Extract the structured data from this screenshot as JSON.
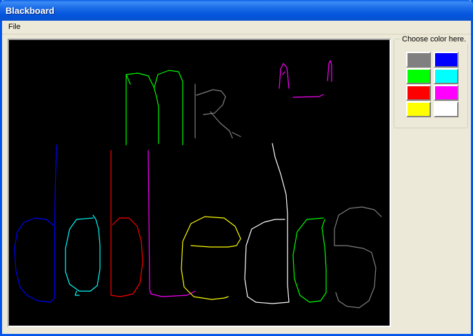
{
  "window": {
    "title": "Blackboard"
  },
  "menu": {
    "items": [
      "File"
    ]
  },
  "palette": {
    "label": "Choose color here.",
    "colors": [
      {
        "name": "gray",
        "hex": "#808080"
      },
      {
        "name": "blue",
        "hex": "#0000FF"
      },
      {
        "name": "green",
        "hex": "#00FF00"
      },
      {
        "name": "cyan",
        "hex": "#00FFFF"
      },
      {
        "name": "red",
        "hex": "#FF0000"
      },
      {
        "name": "magenta",
        "hex": "#FF00FF"
      },
      {
        "name": "yellow",
        "hex": "#FFFF00"
      },
      {
        "name": "white",
        "hex": "#FFFFFF"
      }
    ]
  },
  "canvas": {
    "background": "#000000"
  }
}
